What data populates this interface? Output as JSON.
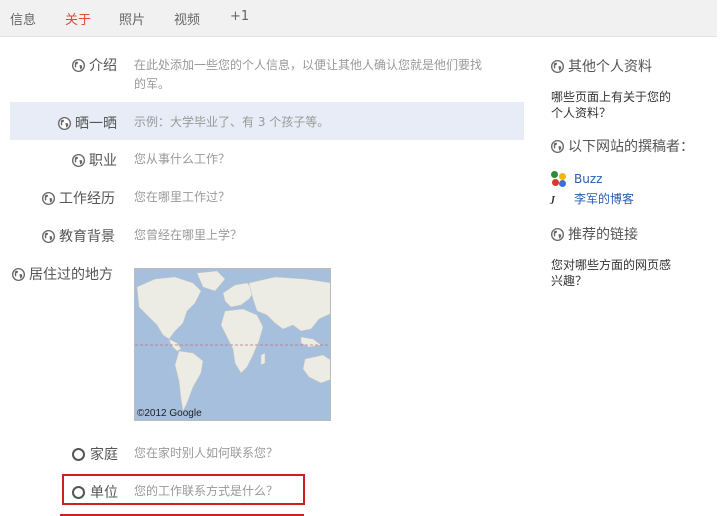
{
  "tabs": [
    {
      "label": "信息",
      "active": false
    },
    {
      "label": "关于",
      "active": true
    },
    {
      "label": "照片",
      "active": false
    },
    {
      "label": "视频",
      "active": false
    },
    {
      "label": "+1",
      "active": false
    }
  ],
  "profile": {
    "intro": {
      "label": "介绍",
      "value_line1": "在此处添加一些您的个人信息，以便让其他人确认您就是他们要找",
      "value_line2": "的军。"
    },
    "bragging": {
      "label": "晒一晒",
      "value": "示例：大学毕业了、有 3 个孩子等。"
    },
    "occupation": {
      "label": "职业",
      "value": "您从事什么工作？"
    },
    "employment": {
      "label": "工作经历",
      "value": "您在哪里工作过？"
    },
    "education": {
      "label": "教育背景",
      "value": "您曾经在哪里上学？"
    },
    "places": {
      "label": "居住过的地方",
      "map_credit": "©2012 Google"
    },
    "home": {
      "label": "家庭",
      "value": "您在家时别人如何联系您？"
    },
    "work": {
      "label": "单位",
      "value": "您的工作联系方式是什么？"
    }
  },
  "sidebar": {
    "other_profiles": {
      "title": "其他个人资料",
      "text_line1": "哪些页面上有关于您的",
      "text_line2": "个人资料？"
    },
    "contributor": {
      "title": "以下网站的撰稿者：",
      "links": [
        {
          "label": "Buzz",
          "icon": "buzz-icon"
        },
        {
          "label": "李军的博客",
          "icon": "blog-icon"
        }
      ]
    },
    "recommended": {
      "title": "推荐的链接",
      "text_line1": "您对哪些方面的网页感",
      "text_line2": "兴趣？"
    }
  },
  "colors": {
    "accent": "#dd4b39",
    "highlight": "#e8ecf7",
    "link": "#2a5db0",
    "annotation": "#cc1f1f"
  }
}
